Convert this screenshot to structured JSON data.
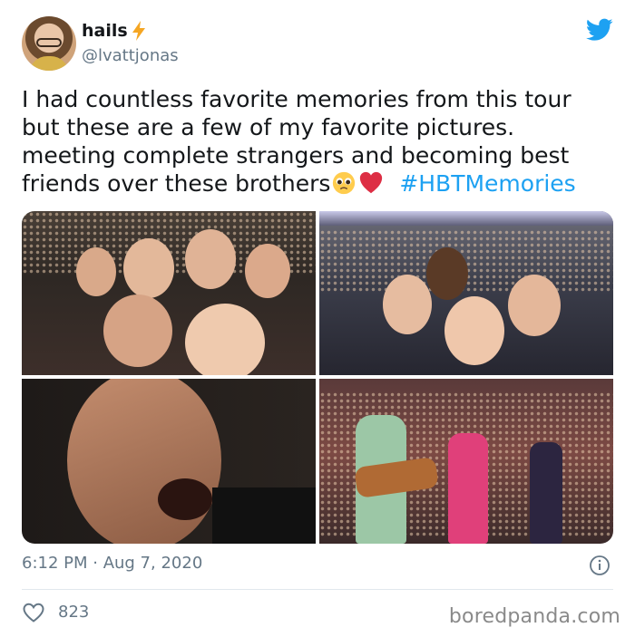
{
  "tweet": {
    "display_name": "hails",
    "handle": "@lvattjonas",
    "text_line1": "I had countless favorite memories from this tour",
    "text_line2": "but these are a few of my favorite pictures.",
    "text_line3": "meeting complete strangers and becoming best",
    "text_line4": "friends over these brothers",
    "hashtag": "#HBTMemories",
    "timestamp": "6:12 PM · Aug 7, 2020",
    "like_count": "823"
  },
  "watermark": "boredpanda.com",
  "icons": {
    "brand": "twitter-bird-icon",
    "name_emoji": "lightning-bolt-icon",
    "emoji_1": "pleading-face-emoji",
    "emoji_2": "red-heart-emoji",
    "info": "info-icon",
    "like": "heart-icon"
  },
  "colors": {
    "twitter_blue": "#1da1f2",
    "secondary_text": "#657786",
    "bolt": "#f5a623",
    "heart_emoji": "#e0245e"
  }
}
